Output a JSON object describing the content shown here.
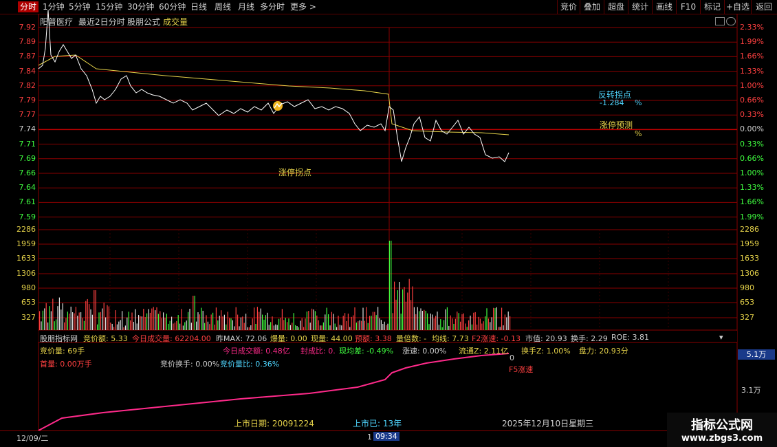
{
  "tabs": [
    {
      "label": "分时",
      "active": true
    },
    {
      "label": "1分钟"
    },
    {
      "label": "5分钟"
    },
    {
      "label": "15分钟"
    },
    {
      "label": "30分钟"
    },
    {
      "label": "60分钟"
    },
    {
      "label": "日线"
    },
    {
      "label": "周线"
    },
    {
      "label": "月线"
    },
    {
      "label": "多分时"
    },
    {
      "label": "更多 >"
    }
  ],
  "right_buttons": [
    "竞价",
    "叠加",
    "超盘",
    "统计",
    "画线",
    "F10",
    "标记",
    "+自选",
    "返回"
  ],
  "chart_header": {
    "stock": "阳普医疗",
    "mode": "最近2日分时",
    "formula": "股朋公式",
    "volume_label": "成交量"
  },
  "price_axis_left": [
    "7.92",
    "7.89",
    "7.87",
    "7.84",
    "7.82",
    "7.79",
    "7.77",
    "7.74",
    "7.71",
    "7.69",
    "7.66",
    "7.64",
    "7.61",
    "7.59"
  ],
  "price_axis_right": [
    "2.33%",
    "1.99%",
    "1.66%",
    "1.33%",
    "1.00%",
    "0.66%",
    "0.33%",
    "0.00%",
    "0.33%",
    "0.66%",
    "1.00%",
    "1.33%",
    "1.66%",
    "1.99%"
  ],
  "volume_axis": [
    "2286",
    "1959",
    "1633",
    "1306",
    "980",
    "653",
    "327"
  ],
  "annotations": {
    "reversal": "反转拐点",
    "reversal_value": "-1.284",
    "pct": "%",
    "limit_forecast": "涨停预测",
    "limit_pct": "%",
    "limit_turn": "涨停拐点"
  },
  "info_row1": {
    "brand": "股朋指标网",
    "auction_amt": "竞价额: 5.33",
    "today_vol": "今日成交量: 62204.00",
    "prev_max": "昨MAX: 72.06",
    "burst": "爆量: 0.00",
    "now_vol": "现量: 44.00",
    "expected": "预额: 3.38",
    "multiple": "量倍数: -",
    "avg": "均线: 7.73",
    "f2": "F2涨速: -0.13",
    "mktcap": "市值: 20.93",
    "turnover": "换手: 2.29",
    "roe": "ROE: 3.81"
  },
  "info_row2": {
    "auction_vol": "竞价量: 69手",
    "today_amt": "今日成交额: 0.48亿",
    "ratio": "封成比: 0.",
    "avg_diff": "现均差: -0.49%",
    "speed": "涨速: 0.00%",
    "float": "流通Z: 2.11亿",
    "turnz": "换手Z: 1.00%",
    "disk": "盘力: 20.93分",
    "zero": "0"
  },
  "info_row3": {
    "first_vol": "首量: 0.00万手",
    "auction_turn": "竞价换手: 0.00%",
    "auction_ratio": "竞价量比: 0.36%",
    "f5": "F5涨速"
  },
  "sub_axis": [
    "5.1万",
    "3.1万"
  ],
  "footer": {
    "listing": "上市日期: 20091224",
    "listed": "上市已: 13年",
    "date": "2025年12月10日星期三"
  },
  "timebar": {
    "left": "12/09/二",
    "cursor": "09:34",
    "cursor_prefix": "1"
  },
  "watermark": {
    "line1": "指标公式网",
    "line2": "www.zbgs3.com"
  },
  "colors": {
    "red_grid": "#8a0000",
    "price_line": "#ffffff",
    "avg_line": "#e6d34a",
    "up": "#ff4040",
    "down": "#40ff40",
    "cum": "#ff2a8a"
  }
}
